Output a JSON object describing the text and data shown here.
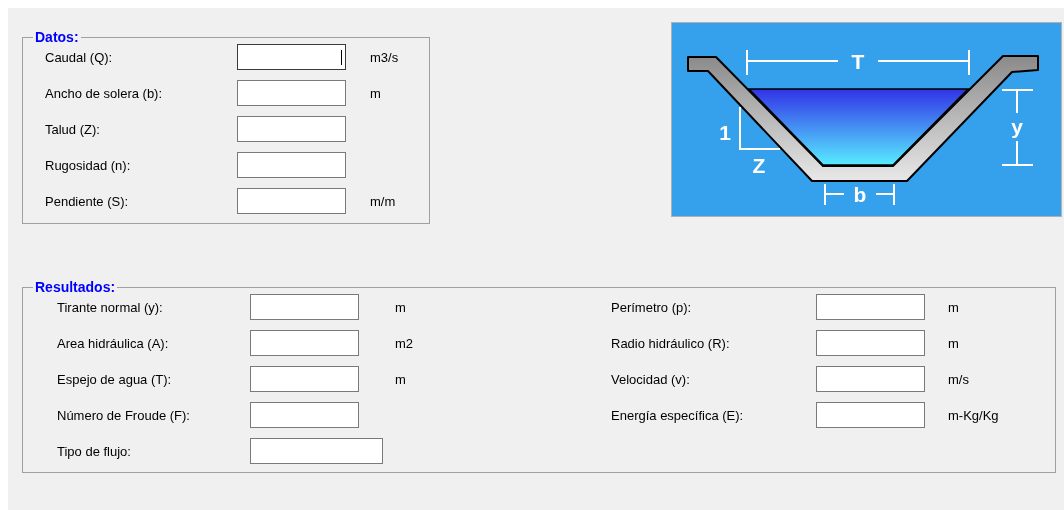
{
  "datos": {
    "title": "Datos:",
    "fields": [
      {
        "label": "Caudal (Q):",
        "unit": "m3/s",
        "focused": true
      },
      {
        "label": "Ancho de solera (b):",
        "unit": "m",
        "focused": false
      },
      {
        "label": "Talud (Z):",
        "focused": false
      },
      {
        "label": "Rugosidad (n):",
        "focused": false
      },
      {
        "label": "Pendiente (S):",
        "unit": "m/m",
        "focused": false
      }
    ]
  },
  "diagram": {
    "top_width": "T",
    "depth": "y",
    "slope_rise": "1",
    "slope_run": "Z",
    "bottom_width": "b"
  },
  "resultados": {
    "title": "Resultados:",
    "columns": [
      [
        {
          "label": "Tirante normal (y):",
          "unit": "m",
          "kind": "number"
        },
        {
          "label": "Area hidráulica (A):",
          "unit": "m2",
          "kind": "number"
        },
        {
          "label": "Espejo de agua (T):",
          "unit": "m",
          "kind": "number"
        },
        {
          "label": "Número de Froude (F):",
          "kind": "number"
        },
        {
          "label": "Tipo de flujo:",
          "kind": "text"
        }
      ],
      [
        {
          "label": "Perímetro (p):",
          "unit": "m",
          "kind": "number"
        },
        {
          "label": "Radio hidráulico (R):",
          "unit": "m",
          "kind": "number"
        },
        {
          "label": "Velocidad (v):",
          "unit": "m/s",
          "kind": "number"
        },
        {
          "label": "Energía específica (E):",
          "unit": "m-Kg/Kg",
          "kind": "number"
        }
      ]
    ]
  }
}
